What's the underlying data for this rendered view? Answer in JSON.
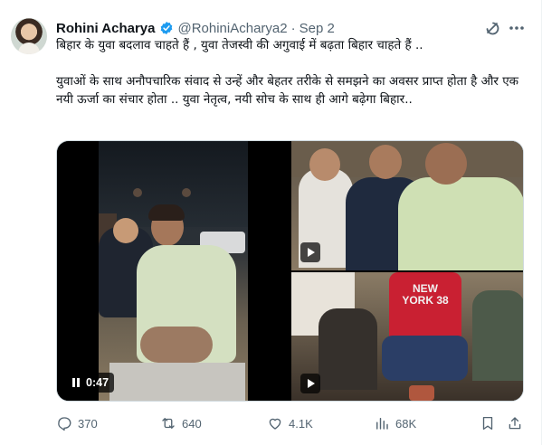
{
  "tweet": {
    "display_name": "Rohini Acharya",
    "handle": "@RohiniAcharya2",
    "separator": "·",
    "date": "Sep 2",
    "line1": "बिहार के युवा बदलाव चाहते हैं , युवा तेजस्वी की अगुवाई में बढ़ता बिहार चाहते हैं ..",
    "para2": "युवाओं के साथ अनौपचारिक संवाद से उन्हें और बेहतर तरीके से समझने का अवसर प्राप्त होता है और एक नयी ऊर्जा का संचार होता .. युवा नेतृत्व, नयी सोच के साथ ही आगे बढ़ेगा बिहार.."
  },
  "media": {
    "video_duration": "0:47",
    "shirt_text": "NEW YORK 38"
  },
  "actions": {
    "replies": "370",
    "reposts": "640",
    "likes": "4.1K",
    "views": "68K"
  },
  "colors": {
    "verified": "#1d9bf0",
    "secondary_text": "#536471",
    "primary_text": "#0f1419",
    "border": "#cfd9de"
  },
  "icons": [
    "verified-badge-icon",
    "grok-icon",
    "more-icon",
    "pause-icon",
    "play-icon",
    "reply-icon",
    "repost-icon",
    "like-icon",
    "views-icon",
    "bookmark-icon",
    "share-icon"
  ]
}
